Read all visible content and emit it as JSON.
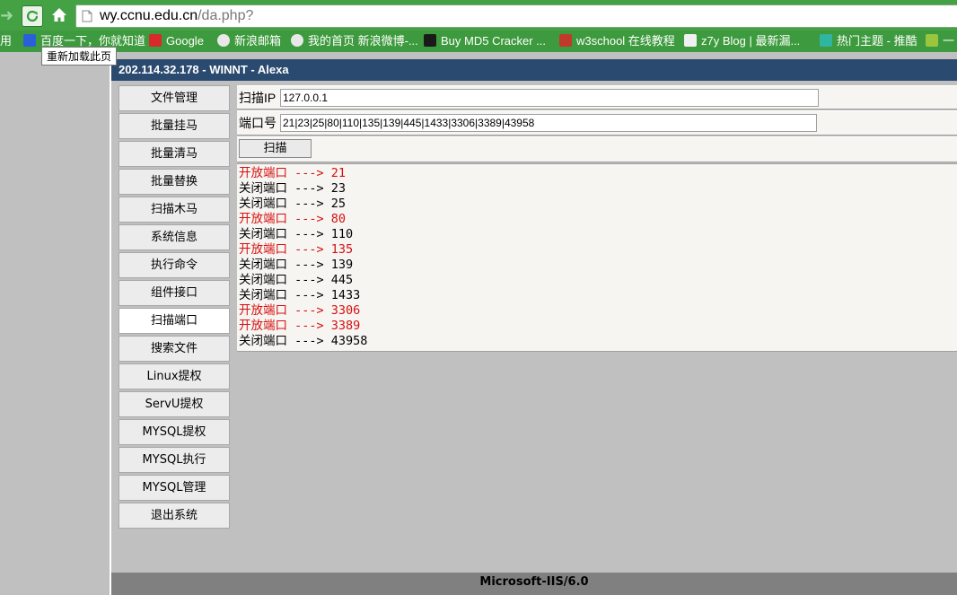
{
  "browser": {
    "url_domain": "wy.ccnu.edu.cn",
    "url_path": "/da.php?",
    "tooltip": "重新加载此页",
    "bookmarks": [
      {
        "label": "用",
        "icon": "apps-icon",
        "color": "#3e9a3e"
      },
      {
        "label": "百度一下，你就知道",
        "icon": "baidu-icon",
        "color": "#2b5fd9"
      },
      {
        "label": "Google",
        "icon": "google-icon",
        "color": "#d82a2a"
      },
      {
        "label": "新浪邮箱",
        "icon": "sina-icon",
        "color": "#e8e8e8"
      },
      {
        "label": "我的首页 新浪微博-...",
        "icon": "weibo-icon",
        "color": "#e8e8e8"
      },
      {
        "label": "Buy MD5 Cracker ...",
        "icon": "md5-icon",
        "color": "#1a1a1a"
      },
      {
        "label": "w3school 在线教程",
        "icon": "w3school-icon",
        "color": "#c0392b"
      },
      {
        "label": "z7y Blog | 最新漏...",
        "icon": "z7y-icon",
        "color": "#f0f0f0"
      },
      {
        "label": "热门主题 - 推酷",
        "icon": "tuicool-icon",
        "color": "#2fb5a0"
      },
      {
        "label": "一",
        "icon": "yi-icon",
        "color": "#9bc53d"
      }
    ]
  },
  "header": {
    "title": "202.114.32.178 - WINNT - Alexa"
  },
  "menu": [
    {
      "label": "文件管理",
      "active": false
    },
    {
      "label": "批量挂马",
      "active": false
    },
    {
      "label": "批量清马",
      "active": false
    },
    {
      "label": "批量替换",
      "active": false
    },
    {
      "label": "扫描木马",
      "active": false
    },
    {
      "label": "系统信息",
      "active": false
    },
    {
      "label": "执行命令",
      "active": false
    },
    {
      "label": "组件接口",
      "active": false
    },
    {
      "label": "扫描端口",
      "active": true
    },
    {
      "label": "搜索文件",
      "active": false
    },
    {
      "label": "Linux提权",
      "active": false
    },
    {
      "label": "ServU提权",
      "active": false
    },
    {
      "label": "MYSQL提权",
      "active": false
    },
    {
      "label": "MYSQL执行",
      "active": false
    },
    {
      "label": "MYSQL管理",
      "active": false
    },
    {
      "label": "退出系统",
      "active": false
    }
  ],
  "scan": {
    "ip_label": "扫描IP",
    "ip_value": "127.0.0.1",
    "port_label": "端口号",
    "port_value": "21|23|25|80|110|135|139|445|1433|3306|3389|43958",
    "button_label": "扫描"
  },
  "results": [
    {
      "status": "开放端口",
      "arrow": "--->",
      "port": "21",
      "open": true
    },
    {
      "status": "关闭端口",
      "arrow": "--->",
      "port": "23",
      "open": false
    },
    {
      "status": "关闭端口",
      "arrow": "--->",
      "port": "25",
      "open": false
    },
    {
      "status": "开放端口",
      "arrow": "--->",
      "port": "80",
      "open": true
    },
    {
      "status": "关闭端口",
      "arrow": "--->",
      "port": "110",
      "open": false
    },
    {
      "status": "开放端口",
      "arrow": "--->",
      "port": "135",
      "open": true
    },
    {
      "status": "关闭端口",
      "arrow": "--->",
      "port": "139",
      "open": false
    },
    {
      "status": "关闭端口",
      "arrow": "--->",
      "port": "445",
      "open": false
    },
    {
      "status": "关闭端口",
      "arrow": "--->",
      "port": "1433",
      "open": false
    },
    {
      "status": "开放端口",
      "arrow": "--->",
      "port": "3306",
      "open": true
    },
    {
      "status": "开放端口",
      "arrow": "--->",
      "port": "3389",
      "open": true
    },
    {
      "status": "关闭端口",
      "arrow": "--->",
      "port": "43958",
      "open": false
    }
  ],
  "footer": {
    "server": "Microsoft-IIS/6.0"
  },
  "colors": {
    "open": "#d41010",
    "closed": "#000000",
    "header_bg": "#2b4a6f"
  }
}
